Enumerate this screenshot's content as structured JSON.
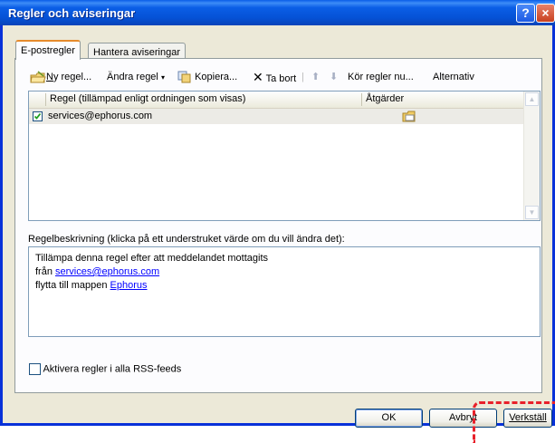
{
  "window": {
    "title": "Regler och aviseringar"
  },
  "titlebar": {
    "help": "?",
    "close": "×"
  },
  "tabs": [
    {
      "label": "E-postregler"
    },
    {
      "label": "Hantera aviseringar"
    }
  ],
  "toolbar": {
    "new_rule": "Ny regel...",
    "new_rule_accel": "N",
    "change_rule": "Ändra regel",
    "change_rule_accel": "Ä",
    "copy": "Kopiera...",
    "copy_accel": "o",
    "delete": "Ta bort",
    "delete_accel": "T",
    "run_rules": "Kör regler nu...",
    "run_rules_accel": "K",
    "options": "Alternativ",
    "options_accel": "l"
  },
  "rules_list": {
    "columns": [
      "Regel (tillämpad enligt ordningen som visas)",
      "Åtgärder"
    ],
    "rows": [
      {
        "name": "services@ephorus.com",
        "checked": true
      }
    ]
  },
  "description": {
    "label": "Regelbeskrivning (klicka på ett understruket värde om du vill ändra det):",
    "line1": "Tillämpa denna regel efter att meddelandet mottagits",
    "line2_prefix": "från ",
    "line2_link": "services@ephorus.com",
    "line3_prefix": "flytta till mappen ",
    "line3_link": "Ephorus"
  },
  "rss": {
    "label": "Aktivera regler i alla RSS-feeds",
    "checked": false
  },
  "buttons": {
    "ok": "OK",
    "cancel": "Avbryt",
    "apply": "Verkställ"
  },
  "colors": {
    "title_bar": "#0a5de8",
    "highlight": "#e8202a",
    "dialog": "#ece9d8"
  }
}
